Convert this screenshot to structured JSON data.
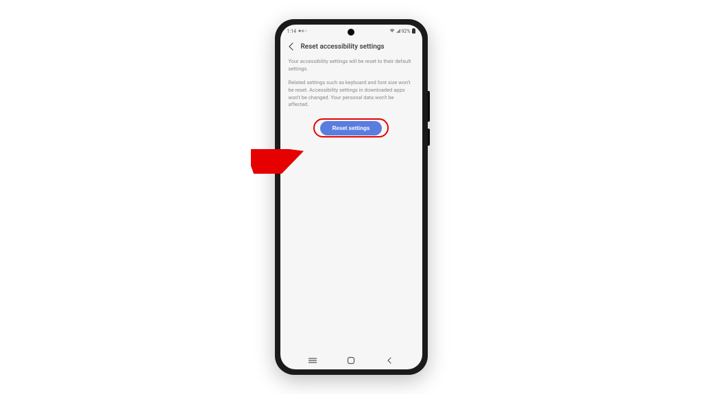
{
  "statusbar": {
    "time": "1:14",
    "battery": "92%"
  },
  "header": {
    "title": "Reset accessibility settings"
  },
  "content": {
    "paragraph1": "Your accessibility settings will be reset to their default settings.",
    "paragraph2": "Related settings such as keyboard and font size won't be reset. Accessibility settings in downloaded apps won't be changed. Your personal data won't be affected."
  },
  "button": {
    "label": "Reset settings"
  }
}
